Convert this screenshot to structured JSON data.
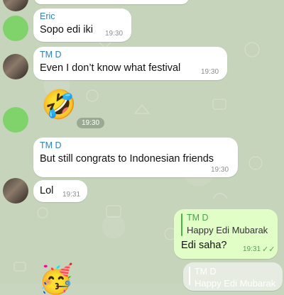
{
  "messages": [
    {
      "sender": "Eric",
      "text": "Sopo edi iki",
      "time": "19:30"
    },
    {
      "sender": "TM D",
      "text": "Even I don’t know what festival",
      "time": "19:30"
    },
    {
      "emoji": "🤣",
      "time": "19:30"
    },
    {
      "sender": "TM D",
      "text": "But still congrats to Indonesian friends",
      "time": "19:30"
    },
    {
      "text": "Lol",
      "time": "19:31"
    }
  ],
  "outgoing": {
    "quote_name": "TM D",
    "quote_text": "Happy Edi Mubarak",
    "text": "Edi saha?",
    "time": "19:31",
    "status": "✓✓"
  },
  "bottom_quote": {
    "quote_name": "TM D",
    "quote_text": "Happy Edi Mubarak"
  },
  "bottom_emoji": "🥳",
  "colors": {
    "background": "#c7d4bc",
    "incoming_bubble": "#ffffff",
    "outgoing_bubble": "#e1fec6",
    "sender_name": "#2b82c7",
    "quote_accent": "#4bb34b"
  }
}
